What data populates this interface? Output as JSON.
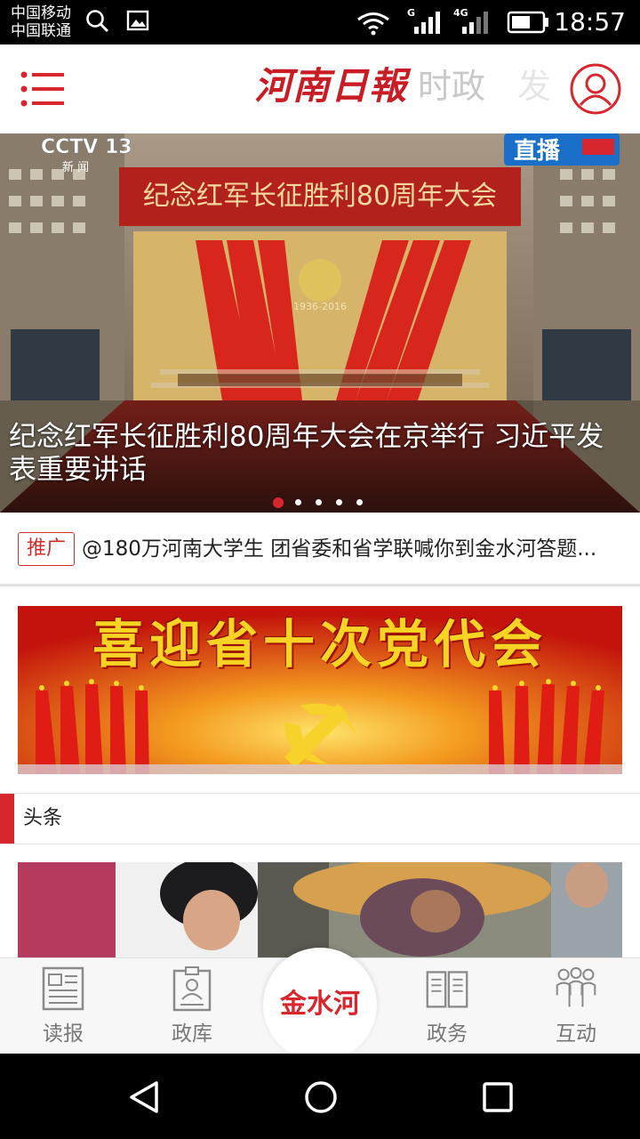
{
  "status_bar": {
    "carrier_1": "中国移动",
    "carrier_2": "中国联通",
    "signal_1_label": "G",
    "signal_2_label": "4G",
    "time": "18:57"
  },
  "header": {
    "logo_text": "河南日報",
    "tabs": [
      {
        "label": "时政"
      },
      {
        "label": "发"
      }
    ]
  },
  "hero": {
    "caption": "纪念红军长征胜利80周年大会在京举行 习近平发表重要讲话",
    "image_overlay": {
      "channel": "CCTV 13",
      "channel_sub": "新 闻",
      "live_badge": "直播",
      "hall_banner": "纪念红军长征胜利80周年大会",
      "emblem_years": "1936-2016"
    },
    "carousel_total": 5,
    "carousel_active_index": 0
  },
  "promo": {
    "tag": "推广",
    "text": "@180万河南大学生 团省委和省学联喊你到金水河答题..."
  },
  "banner": {
    "title": "喜迎省十次党代会"
  },
  "section": {
    "title": "头条"
  },
  "bottom_nav": {
    "items": [
      {
        "label": "读报",
        "icon": "newspaper-icon"
      },
      {
        "label": "政库",
        "icon": "id-card-icon"
      },
      {
        "label": "政务",
        "icon": "book-open-icon"
      },
      {
        "label": "互动",
        "icon": "people-icon"
      }
    ],
    "center_label": "金水河"
  },
  "colors": {
    "accent": "#d7262e",
    "logo": "#c81d25",
    "nav_label": "#777777"
  }
}
